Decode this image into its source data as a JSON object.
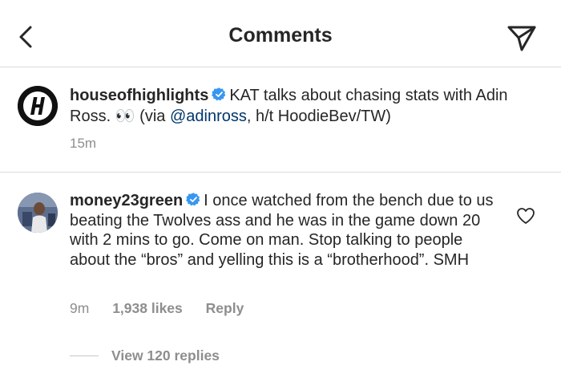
{
  "header": {
    "title": "Comments",
    "back_icon": "chevron-left-icon",
    "send_icon": "paper-plane-icon"
  },
  "post": {
    "username": "houseofhighlights",
    "avatar_letter": "H",
    "text_main": "KAT talks about chasing stats with Adin Ross.",
    "emoji": "👀",
    "via_prefix": "(via",
    "mention": "@adinross",
    "via_suffix": ", h/t HoodieBev/TW)",
    "time": "15m"
  },
  "comment": {
    "username": "money23green",
    "text": "I once watched from the bench due to us beating the Twolves ass and he was in the game down 20 with 2 mins to go. Come on man. Stop talking to people about the “bros” and yelling this is a “brotherhood”. SMH",
    "time": "9m",
    "likes": "1,938 likes",
    "reply_label": "Reply",
    "view_replies": "View 120 replies"
  },
  "colors": {
    "verified": "#3897f0",
    "link": "#00376b",
    "muted": "#8e8e8e",
    "text": "#262626"
  }
}
